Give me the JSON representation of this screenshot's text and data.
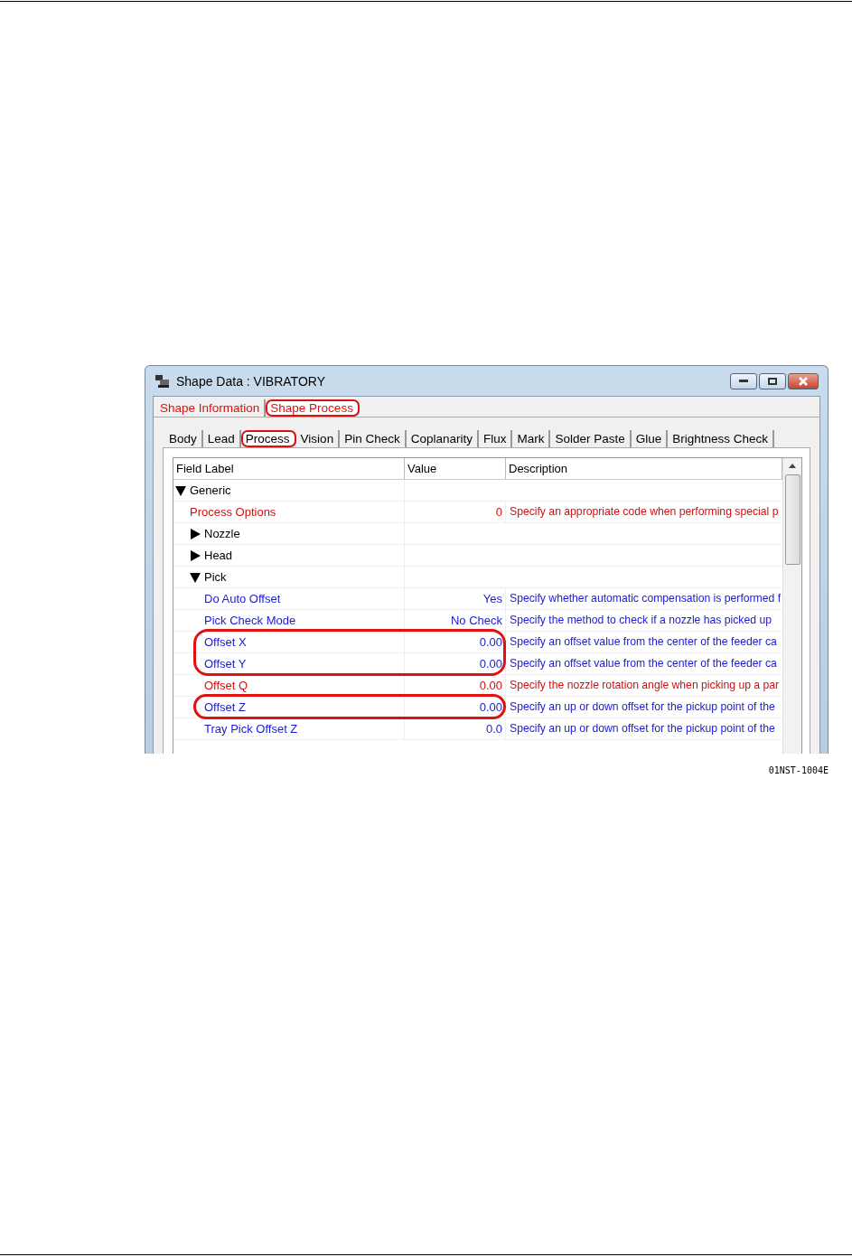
{
  "window": {
    "title": "Shape Data : VIBRATORY"
  },
  "outer_tabs": [
    {
      "label": "Shape Information",
      "selected": false,
      "circled": false
    },
    {
      "label": "Shape Process",
      "selected": true,
      "circled": true
    }
  ],
  "inner_tabs": [
    {
      "label": "Body",
      "selected": false,
      "circled": false
    },
    {
      "label": "Lead",
      "selected": false,
      "circled": false
    },
    {
      "label": "Process",
      "selected": true,
      "circled": true
    },
    {
      "label": "Vision",
      "selected": false,
      "circled": false
    },
    {
      "label": "Pin Check",
      "selected": false,
      "circled": false
    },
    {
      "label": "Coplanarity",
      "selected": false,
      "circled": false
    },
    {
      "label": "Flux",
      "selected": false,
      "circled": false
    },
    {
      "label": "Mark",
      "selected": false,
      "circled": false
    },
    {
      "label": "Solder Paste",
      "selected": false,
      "circled": false
    },
    {
      "label": "Glue",
      "selected": false,
      "circled": false
    },
    {
      "label": "Brightness Check",
      "selected": false,
      "circled": false
    }
  ],
  "table": {
    "columns": [
      "Field Label",
      "Value",
      "Description"
    ],
    "rows": [
      {
        "kind": "group",
        "label": "Generic",
        "expanded": true,
        "children": [
          {
            "kind": "field",
            "label": "Process Options",
            "value": "0",
            "description": "Specify an appropriate code when performing special p",
            "color": "#d01010",
            "circled": false
          },
          {
            "kind": "group",
            "label": "Nozzle",
            "expanded": false
          },
          {
            "kind": "group",
            "label": "Head",
            "expanded": false
          },
          {
            "kind": "group",
            "label": "Pick",
            "expanded": true,
            "children": [
              {
                "kind": "field",
                "label": "Do Auto Offset",
                "value": "Yes",
                "description": "Specify whether automatic compensation is performed f",
                "color": "#1a1ad0",
                "circled": false
              },
              {
                "kind": "field",
                "label": "Pick Check Mode",
                "value": "No Check",
                "description": "Specify the method to check if a nozzle has picked up",
                "color": "#1a1ad0",
                "circled": false
              },
              {
                "kind": "field",
                "label": "Offset X",
                "value": "0.00",
                "description": "Specify an offset value from the center of the feeder ca",
                "color": "#1a1ad0",
                "circled": true
              },
              {
                "kind": "field",
                "label": "Offset Y",
                "value": "0.00",
                "description": "Specify an offset value from the center of the feeder ca",
                "color": "#1a1ad0",
                "circled": true
              },
              {
                "kind": "field",
                "label": "Offset Q",
                "value": "0.00",
                "description": "Specify the nozzle rotation angle when picking up a par",
                "color": "#d01010",
                "circled": false
              },
              {
                "kind": "field",
                "label": "Offset Z",
                "value": "0.00",
                "description": "Specify an up or down offset for the pickup point of the",
                "color": "#1a1ad0",
                "circled": true
              },
              {
                "kind": "field",
                "label": "Tray Pick Offset Z",
                "value": "0.0",
                "description": "Specify an up or down offset for the pickup point of the",
                "color": "#1a1ad0",
                "circled": false
              }
            ]
          }
        ]
      }
    ]
  },
  "figure_code": "01NST-1004E"
}
